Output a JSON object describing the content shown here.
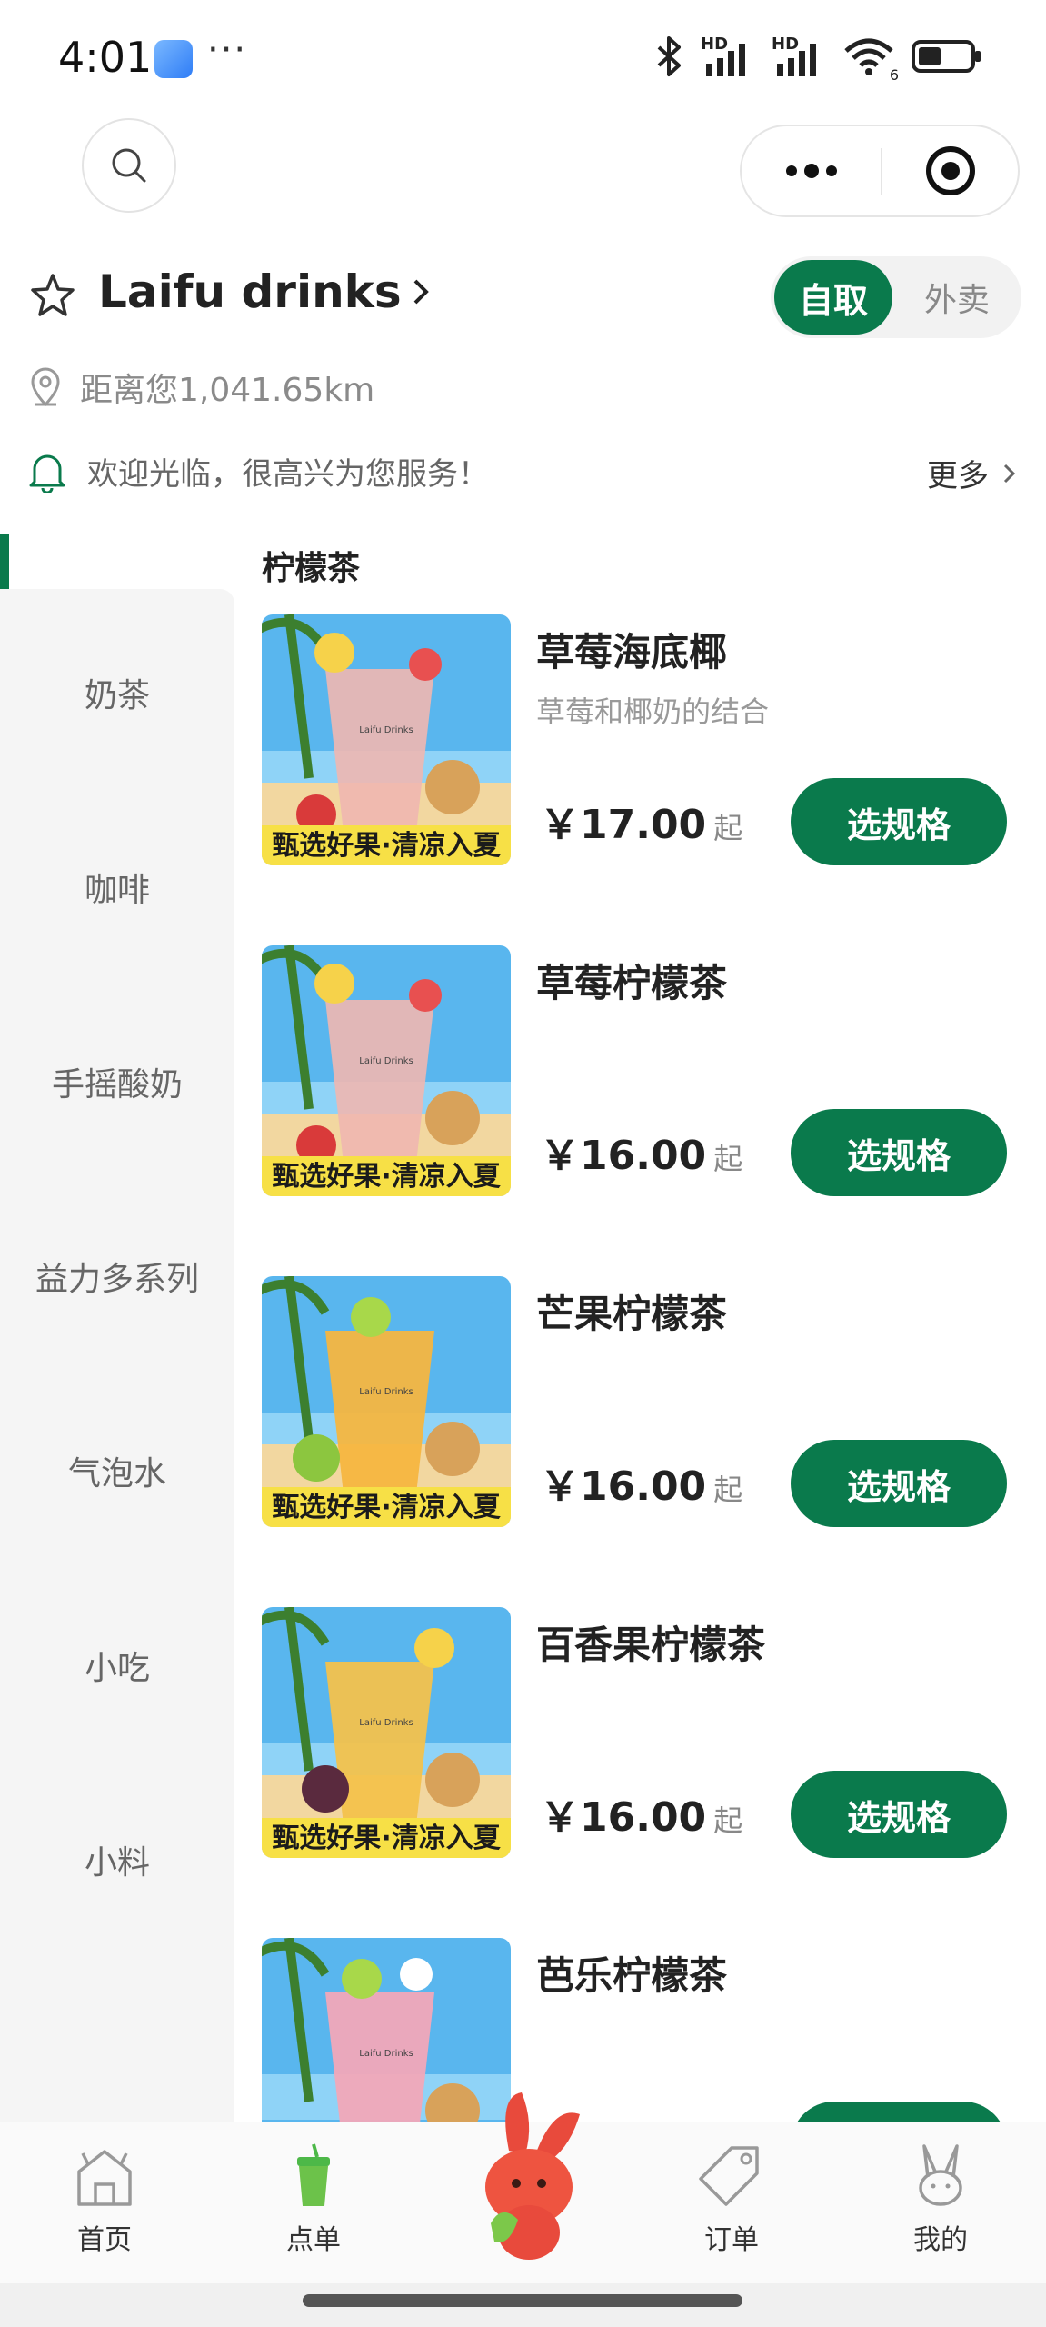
{
  "status_bar": {
    "time": "4:01",
    "dots": "···",
    "net1": "HD",
    "net2": "HD",
    "wifi_badge": "6"
  },
  "store": {
    "name": "Laifu drinks",
    "distance": "距离您1,041.65km",
    "mode_pickup": "自取",
    "mode_delivery": "外卖"
  },
  "notice": {
    "text": "欢迎光临，很高兴为您服务！",
    "more_label": "更多"
  },
  "categories": [
    "奶茶",
    "咖啡",
    "手摇酸奶",
    "益力多系列",
    "气泡水",
    "小吃",
    "小料"
  ],
  "section_title": "柠檬茶",
  "products": [
    {
      "name": "草莓海底椰",
      "desc": "草莓和椰奶的结合",
      "price": "￥17.00",
      "suffix": "起",
      "button": "选规格"
    },
    {
      "name": "草莓柠檬茶",
      "desc": "",
      "price": "￥16.00",
      "suffix": "起",
      "button": "选规格"
    },
    {
      "name": "芒果柠檬茶",
      "desc": "",
      "price": "￥16.00",
      "suffix": "起",
      "button": "选规格"
    },
    {
      "name": "百香果柠檬茶",
      "desc": "",
      "price": "￥16.00",
      "suffix": "起",
      "button": "选规格"
    },
    {
      "name": "芭乐柠檬茶",
      "desc": "",
      "price": "",
      "suffix": "",
      "button": ""
    }
  ],
  "product_image": {
    "banner": "甄选好果·清凉入夏",
    "brand": "Laifu Drinks"
  },
  "tabbar": {
    "home": "首页",
    "order": "点单",
    "orders": "订单",
    "mine": "我的"
  },
  "colors": {
    "accent": "#0a7a4c",
    "sidebar_bg": "#f5f5f5"
  }
}
